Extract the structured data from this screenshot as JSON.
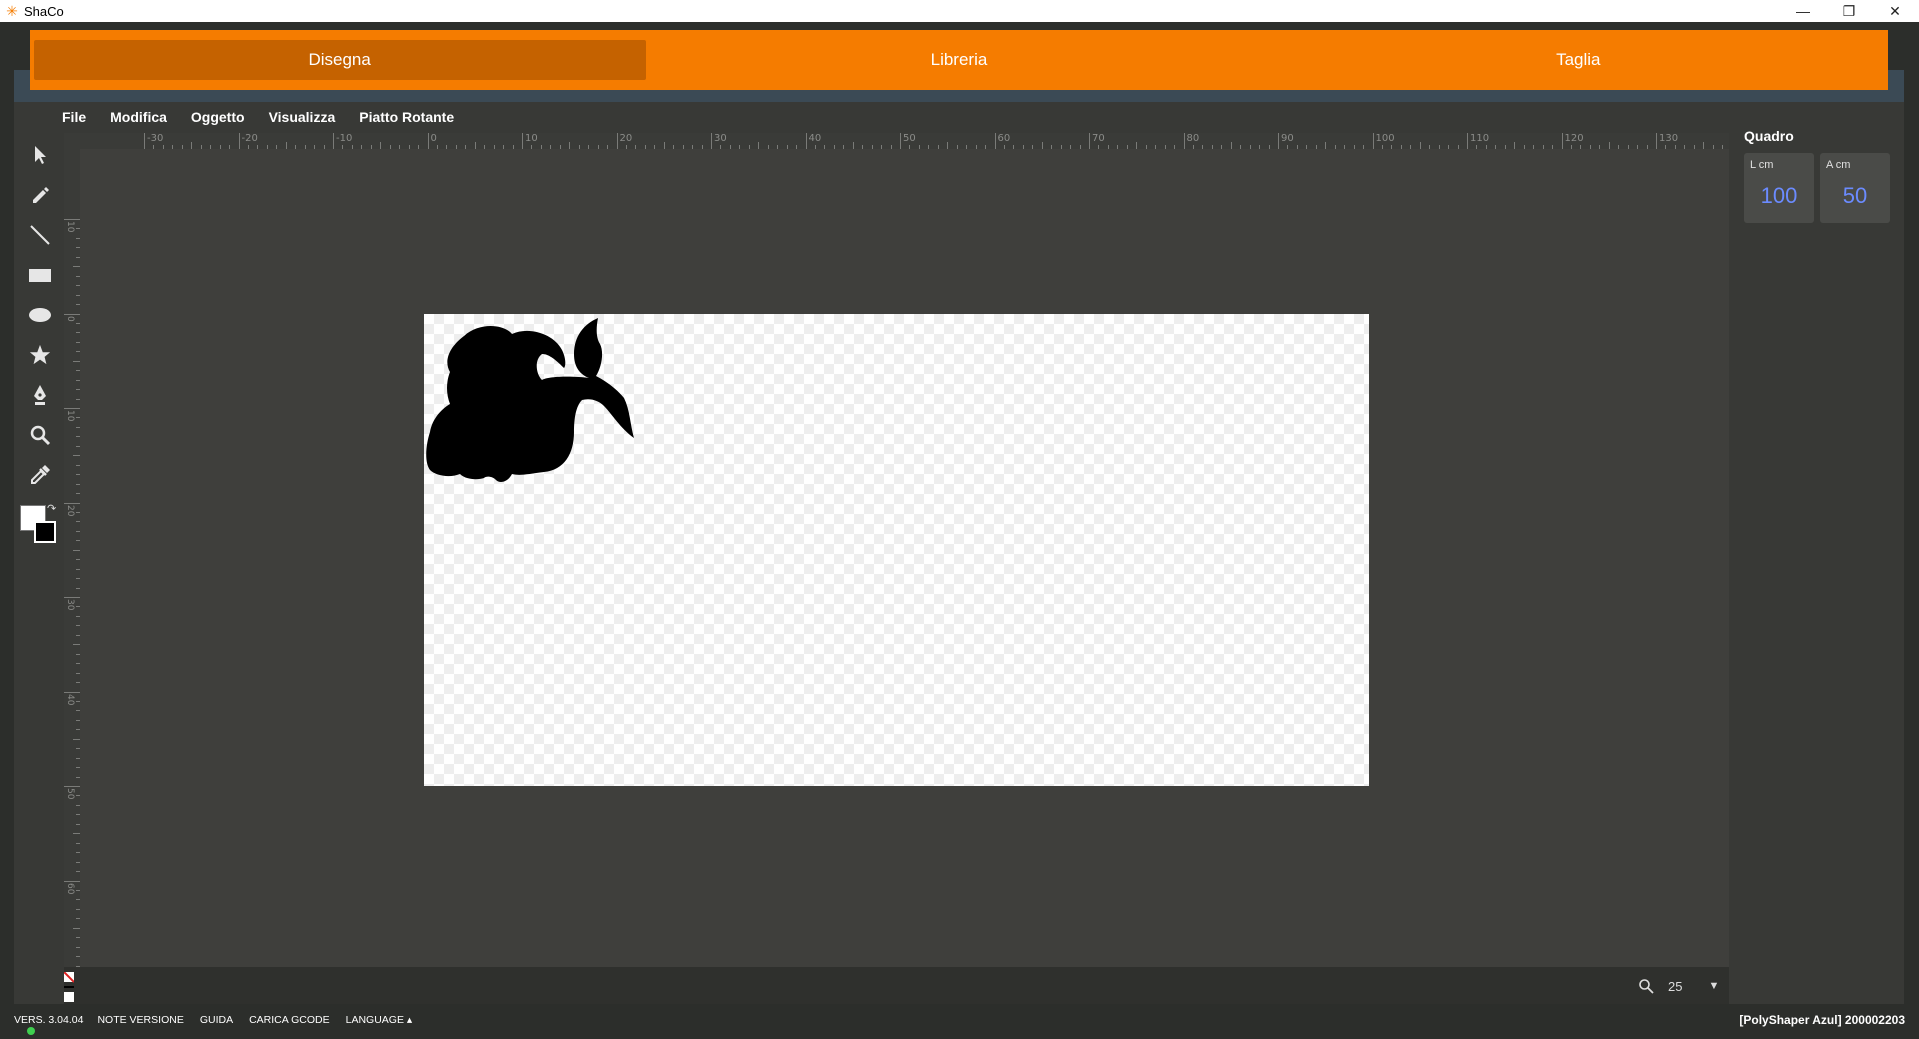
{
  "window": {
    "title": "ShaCo"
  },
  "topnav": {
    "tabs": [
      {
        "label": "Disegna",
        "active": true
      },
      {
        "label": "Libreria",
        "active": false
      },
      {
        "label": "Taglia",
        "active": false
      }
    ]
  },
  "menu": {
    "items": [
      "File",
      "Modifica",
      "Oggetto",
      "Visualizza",
      "Piatto Rotante"
    ]
  },
  "tools": [
    "pointer-icon",
    "pencil-icon",
    "line-icon",
    "rectangle-icon",
    "ellipse-icon",
    "star-icon",
    "pen-nib-icon",
    "magnifier-icon",
    "eyedropper-icon"
  ],
  "colors": {
    "accent": "#f57c00",
    "accent_active": "#c56200",
    "fill": "#ffffff",
    "stroke": "#000000",
    "value_blue": "#6b8bff"
  },
  "ruler": {
    "top_labels": [
      "-30",
      "-20",
      "-10",
      "0",
      "10",
      "20",
      "30",
      "40",
      "50",
      "60",
      "70",
      "80",
      "90",
      "100",
      "110",
      "120",
      "130"
    ],
    "left_labels": [
      "10",
      "0",
      "10",
      "20",
      "30",
      "40",
      "50",
      "60"
    ]
  },
  "panel": {
    "title": "Quadro",
    "width_label": "L cm",
    "width_value": "100",
    "height_label": "A cm",
    "height_value": "50"
  },
  "zoom": {
    "value": "25"
  },
  "statusbar": {
    "version": "VERS. 3.04.04",
    "links": [
      "NOTE VERSIONE",
      "GUIDA",
      "CARICA GCODE",
      "LANGUAGE ▴"
    ],
    "machine": "[PolyShaper Azul] 200002203"
  }
}
